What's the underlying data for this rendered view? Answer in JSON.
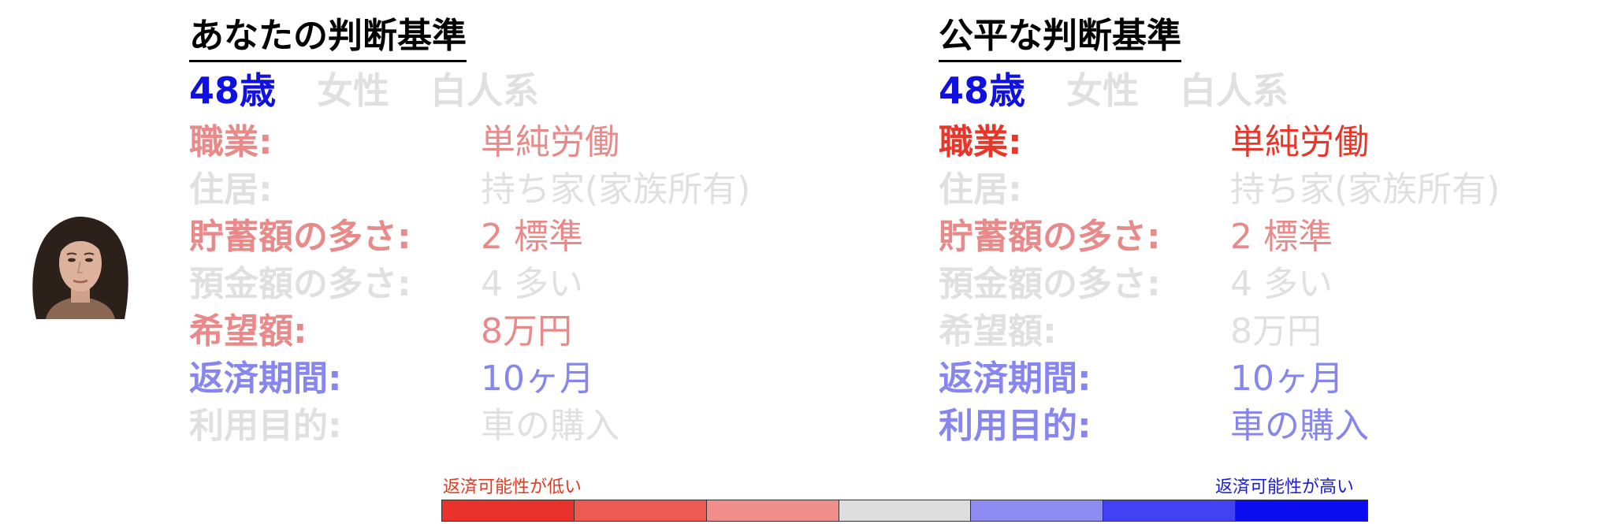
{
  "colors": {
    "red_strong": "#e8372a",
    "red_soft": "#e98a8a",
    "blue_strong": "#1010e0",
    "blue_soft": "#8686ee",
    "gray": "#e0e0e0",
    "scale_red_text": "#e23a20",
    "scale_blue_text": "#1a1ad8"
  },
  "person": {
    "photo_icon": "portrait-photo"
  },
  "left_panel": {
    "title": "あなたの判断基準",
    "demographics": {
      "age": "48歳",
      "gender": "女性",
      "ethnicity": "白人系"
    },
    "rows": [
      {
        "label": "職業:",
        "value": "単純労働",
        "emphasis": "red_soft"
      },
      {
        "label": "住居:",
        "value": "持ち家(家族所有)",
        "emphasis": "gray"
      },
      {
        "label": "貯蓄額の多さ:",
        "value": "2 標準",
        "emphasis": "red_soft"
      },
      {
        "label": "預金額の多さ:",
        "value": "4 多い",
        "emphasis": "gray"
      },
      {
        "label": "希望額:",
        "value": "8万円",
        "emphasis": "red_soft"
      },
      {
        "label": "返済期間:",
        "value": "10ヶ月",
        "emphasis": "blue_soft"
      },
      {
        "label": "利用目的:",
        "value": "車の購入",
        "emphasis": "gray"
      }
    ]
  },
  "right_panel": {
    "title": "公平な判断基準",
    "demographics": {
      "age": "48歳",
      "gender": "女性",
      "ethnicity": "白人系"
    },
    "rows": [
      {
        "label": "職業:",
        "value": "単純労働",
        "emphasis": "red_strong"
      },
      {
        "label": "住居:",
        "value": "持ち家(家族所有)",
        "emphasis": "gray"
      },
      {
        "label": "貯蓄額の多さ:",
        "value": "2 標準",
        "emphasis": "red_soft"
      },
      {
        "label": "預金額の多さ:",
        "value": "4 多い",
        "emphasis": "gray"
      },
      {
        "label": "希望額:",
        "value": "8万円",
        "emphasis": "gray"
      },
      {
        "label": "返済期間:",
        "value": "10ヶ月",
        "emphasis": "blue_soft"
      },
      {
        "label": "利用目的:",
        "value": "車の購入",
        "emphasis": "blue_soft"
      }
    ]
  },
  "scale": {
    "low_label": "返済可能性が低い",
    "high_label": "返済可能性が高い",
    "segment_colors": [
      "#e8322b",
      "#ec5a52",
      "#ef8e8b",
      "#dedede",
      "#8c8cf2",
      "#4242f2",
      "#0c0cf0"
    ]
  }
}
